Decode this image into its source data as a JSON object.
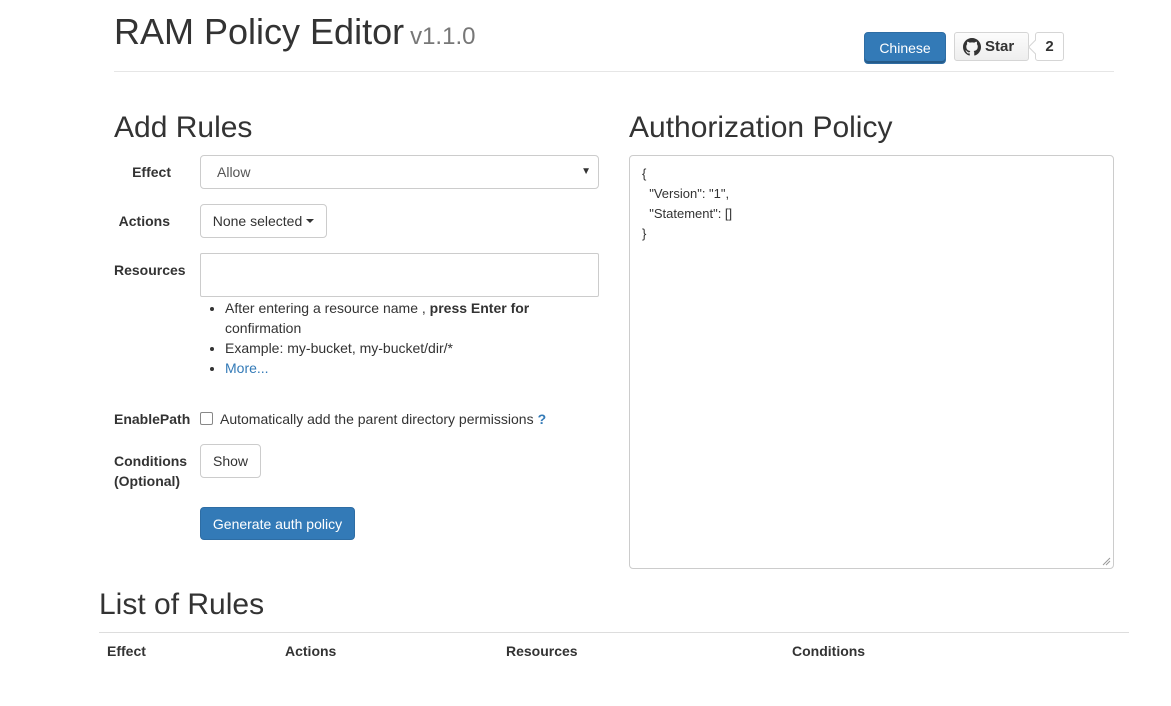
{
  "header": {
    "title": "RAM Policy Editor",
    "version": "v1.1.0",
    "language_button": "Chinese",
    "github": {
      "star_label": "Star",
      "star_count": "2",
      "icon": "github-icon"
    }
  },
  "add_rules": {
    "heading": "Add Rules",
    "effect": {
      "label": "Effect",
      "selected": "Allow"
    },
    "actions": {
      "label": "Actions",
      "button": "None selected"
    },
    "resources": {
      "label": "Resources",
      "value": "",
      "help": {
        "line1_prefix": "After entering a resource name , ",
        "line1_bold": "press Enter for",
        "line1_cont": "confirmation",
        "line2": "Example: my-bucket, my-bucket/dir/*",
        "more_link": "More..."
      }
    },
    "enable_path": {
      "label": "EnablePath",
      "checked": false,
      "text": "Automatically add the parent directory permissions",
      "help_mark": "?"
    },
    "conditions": {
      "label_line1": "Conditions",
      "label_line2": "(Optional)",
      "button": "Show"
    },
    "generate_button": "Generate auth policy"
  },
  "authorization_policy": {
    "heading": "Authorization Policy",
    "json_text": "{\n  \"Version\": \"1\",\n  \"Statement\": []\n}"
  },
  "list_of_rules": {
    "heading": "List of Rules",
    "columns": [
      "Effect",
      "Actions",
      "Resources",
      "Conditions"
    ]
  },
  "colors": {
    "primary": "#337ab7",
    "text": "#333333",
    "muted": "#777777",
    "border": "#cccccc"
  }
}
